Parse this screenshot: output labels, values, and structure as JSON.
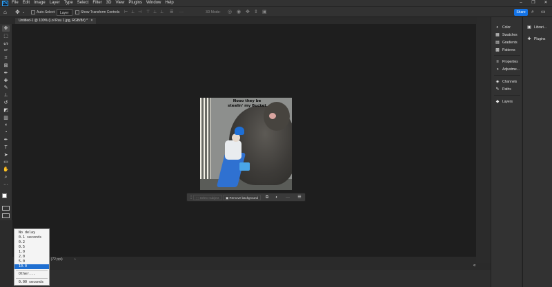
{
  "menubar": {
    "logo": "Ps",
    "items": [
      "File",
      "Edit",
      "Image",
      "Layer",
      "Type",
      "Select",
      "Filter",
      "3D",
      "View",
      "Plugins",
      "Window",
      "Help"
    ],
    "window_controls": [
      "–",
      "❐",
      "✕"
    ]
  },
  "options_bar": {
    "auto_select_label": "Auto-Select:",
    "auto_select_value": "Layer",
    "show_transform_label": "Show Transform Controls",
    "mode_3d_label": "3D Mode:",
    "share_label": "Share"
  },
  "tab": {
    "title": "Untitled-1 @ 100% (Lol Ruu 1.jpg, RGB/8#) *",
    "close": "×"
  },
  "image": {
    "caption": "Nooo they be\nstealin' my Bucket"
  },
  "taskbar": {
    "select_subject": "Select subject",
    "remove_background": "Remove background"
  },
  "status": {
    "text": "px (72 ppi)",
    "arrow": "›"
  },
  "right_panels": {
    "col1": [
      {
        "icon": "color-icon",
        "glyph": "◐",
        "label": "Color"
      },
      {
        "icon": "swatches-icon",
        "glyph": "▦",
        "label": "Swatches"
      },
      {
        "icon": "gradients-icon",
        "glyph": "▤",
        "label": "Gradients"
      },
      {
        "icon": "patterns-icon",
        "glyph": "▩",
        "label": "Patterns"
      },
      {
        "icon": "properties-icon",
        "glyph": "≡",
        "label": "Properties"
      },
      {
        "icon": "adjustments-icon",
        "glyph": "◑",
        "label": "Adjustme..."
      },
      {
        "icon": "channels-icon",
        "glyph": "◈",
        "label": "Channels"
      },
      {
        "icon": "paths-icon",
        "glyph": "✎",
        "label": "Paths"
      },
      {
        "icon": "layers-icon",
        "glyph": "◆",
        "label": "Layers"
      }
    ],
    "col2": [
      {
        "icon": "libraries-icon",
        "glyph": "▣",
        "label": "Librari..."
      },
      {
        "icon": "plugins-icon",
        "glyph": "✚",
        "label": "Plugins"
      }
    ]
  },
  "delay_menu": {
    "options": [
      "No delay",
      "0.1 seconds",
      "0.2",
      "0.5",
      "1.0",
      "2.0",
      "5.0",
      "10.0"
    ],
    "selected": "10.0",
    "other": "Other...",
    "current": "0.00 seconds"
  },
  "tools": [
    {
      "name": "move-tool-icon",
      "glyph": "✥"
    },
    {
      "name": "artboard-tool-icon",
      "glyph": "⬚"
    },
    {
      "name": "lasso-tool-icon",
      "glyph": "ᔕ"
    },
    {
      "name": "quick-selection-tool-icon",
      "glyph": "✑"
    },
    {
      "name": "crop-tool-icon",
      "glyph": "⌗"
    },
    {
      "name": "frame-tool-icon",
      "glyph": "⊠"
    },
    {
      "name": "eyedropper-tool-icon",
      "glyph": "✒"
    },
    {
      "name": "healing-brush-tool-icon",
      "glyph": "✚"
    },
    {
      "name": "brush-tool-icon",
      "glyph": "✎"
    },
    {
      "name": "clone-stamp-tool-icon",
      "glyph": "⊥"
    },
    {
      "name": "history-brush-tool-icon",
      "glyph": "↺"
    },
    {
      "name": "eraser-tool-icon",
      "glyph": "◩"
    },
    {
      "name": "gradient-tool-icon",
      "glyph": "▥"
    },
    {
      "name": "blur-tool-icon",
      "glyph": "◖"
    },
    {
      "name": "dodge-tool-icon",
      "glyph": "◔"
    },
    {
      "name": "pen-tool-icon",
      "glyph": "✒"
    },
    {
      "name": "type-tool-icon",
      "glyph": "T"
    },
    {
      "name": "path-selection-tool-icon",
      "glyph": "➤"
    },
    {
      "name": "rectangle-tool-icon",
      "glyph": "▭"
    },
    {
      "name": "hand-tool-icon",
      "glyph": "✋"
    },
    {
      "name": "zoom-tool-icon",
      "glyph": "⌕"
    },
    {
      "name": "more-tools-icon",
      "glyph": "···"
    }
  ],
  "colors": {
    "accent": "#1473e6",
    "selection": "#1f6fd1",
    "canvas": "#1e1e1e",
    "panel": "#323232"
  }
}
